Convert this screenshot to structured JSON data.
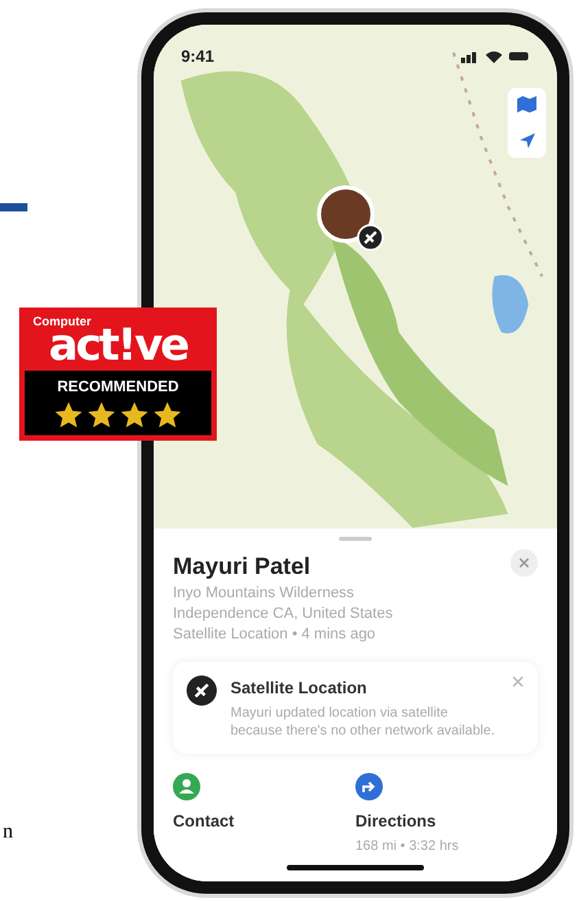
{
  "status_bar": {
    "time": "9:41"
  },
  "person": {
    "name": "Mayuri Patel",
    "lines": [
      "Inyo Mountains Wilderness",
      "Independence CA, United States",
      "Satellite Location • 4 mins ago"
    ]
  },
  "notice": {
    "title": "Satellite Location",
    "text": "Mayuri updated location via satellite because there's no other network available."
  },
  "actions": [
    {
      "kind": "contact",
      "label": "Contact",
      "color": "#34a853"
    },
    {
      "kind": "directions",
      "label": "Directions",
      "detail": "168 mi • 3:32 hrs",
      "color": "#2f6fd6"
    }
  ],
  "badge": {
    "brand_top": "Computer",
    "brand": "act!ve",
    "label": "RECOMMENDED",
    "stars": 4
  },
  "edge_text": "n"
}
